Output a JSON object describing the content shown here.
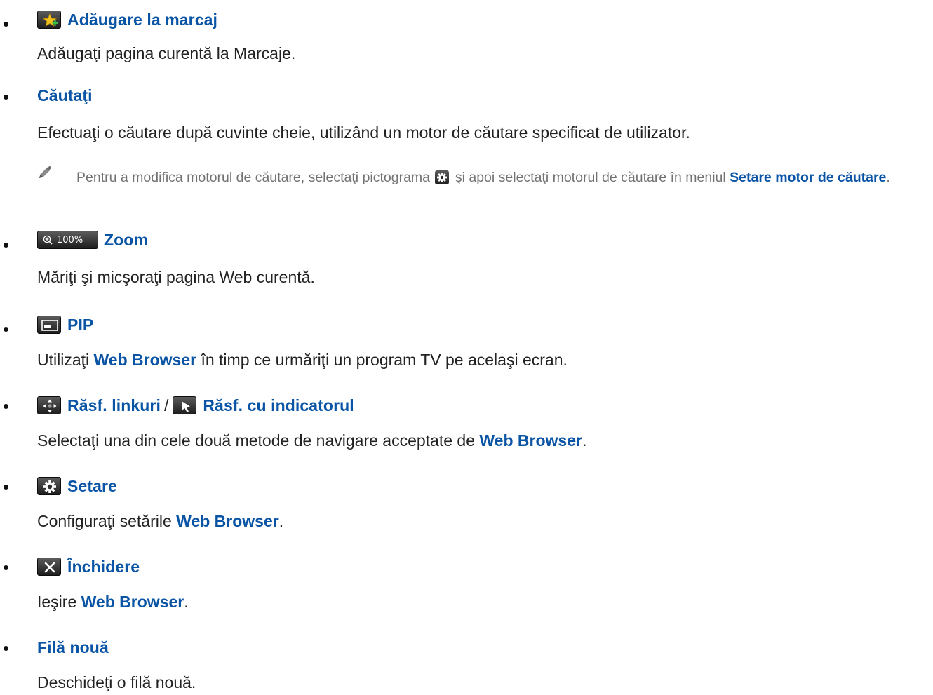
{
  "items": [
    {
      "title": "Adăugare la marcaj",
      "icon": "add-bookmark-star-icon",
      "description": "Adăugaţi pagina curentă la Marcaje."
    },
    {
      "title": "Căutaţi",
      "description": "Efectuaţi o căutare după cuvinte cheie, utilizând un motor de căutare specificat de utilizator.",
      "note": {
        "icon": "pencil-note-icon",
        "text_before": "Pentru a modifica motorul de căutare, selectaţi pictograma",
        "inline_icon": "gear-icon",
        "text_middle": "şi apoi selectaţi motorul de căutare în meniul",
        "bold": "Setare motor de căutare",
        "text_after": "."
      }
    },
    {
      "title": "Zoom",
      "icon": "zoom-icon",
      "icon_label": "100%",
      "description": "Măriţi şi micşoraţi pagina Web curentă."
    },
    {
      "title": "PIP",
      "icon": "pip-icon",
      "description_prefix": "Utilizaţi",
      "description_bold": "Web Browser",
      "description_suffix": "în timp ce urmăriţi un program TV pe acelaşi ecran."
    },
    {
      "title": "Răsf. linkuri",
      "icon": "link-browse-arrows-icon",
      "separator": "/",
      "title_2": "Răsf. cu indicatorul",
      "icon_2": "pointer-cursor-icon",
      "description_prefix": "Selectaţi una din cele două metode de navigare acceptate de",
      "description_bold": "Web Browser",
      "description_suffix": "."
    },
    {
      "title": "Setare",
      "icon": "gear-icon",
      "description_prefix": "Configuraţi setările",
      "description_bold": "Web Browser",
      "description_suffix": "."
    },
    {
      "title": "Închidere",
      "icon": "close-icon",
      "description_prefix": "Ieşire",
      "description_bold": "Web Browser",
      "description_suffix": "."
    },
    {
      "title": "Filă nouă",
      "description": "Deschideţi o filă nouă."
    }
  ],
  "colors": {
    "heading_blue": "#0a54a6",
    "body_text": "#222222",
    "note_text": "#727272"
  }
}
